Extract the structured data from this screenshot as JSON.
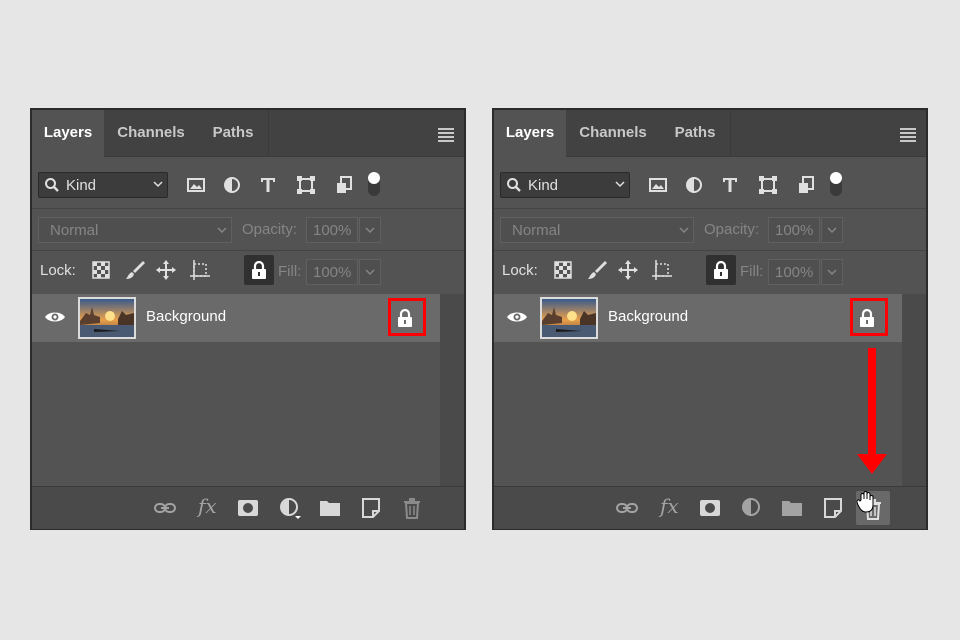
{
  "panels": [
    {
      "tabs": [
        "Layers",
        "Channels",
        "Paths"
      ],
      "filter": {
        "kind_label": "Kind"
      },
      "blend_mode": "Normal",
      "opacity_label": "Opacity:",
      "opacity_value": "100%",
      "lock_label": "Lock:",
      "fill_label": "Fill:",
      "fill_value": "100%",
      "layer": {
        "name": "Background",
        "locked": true
      },
      "highlight_color": "#ff0000",
      "footer_icons": [
        "link-icon",
        "fx-icon",
        "mask-icon",
        "adjustment-icon",
        "folder-icon",
        "new-layer-icon",
        "trash-icon"
      ]
    },
    {
      "tabs": [
        "Layers",
        "Channels",
        "Paths"
      ],
      "filter": {
        "kind_label": "Kind"
      },
      "blend_mode": "Normal",
      "opacity_label": "Opacity:",
      "opacity_value": "100%",
      "lock_label": "Lock:",
      "fill_label": "Fill:",
      "fill_value": "100%",
      "layer": {
        "name": "Background",
        "locked": true
      },
      "highlight_color": "#ff0000",
      "annotation": "red arrow pointing from layer lock icon to trash icon",
      "footer_icons": [
        "link-icon",
        "fx-icon",
        "mask-icon",
        "adjustment-icon",
        "folder-icon",
        "new-layer-icon",
        "trash-icon"
      ]
    }
  ],
  "fx_text": "fx"
}
